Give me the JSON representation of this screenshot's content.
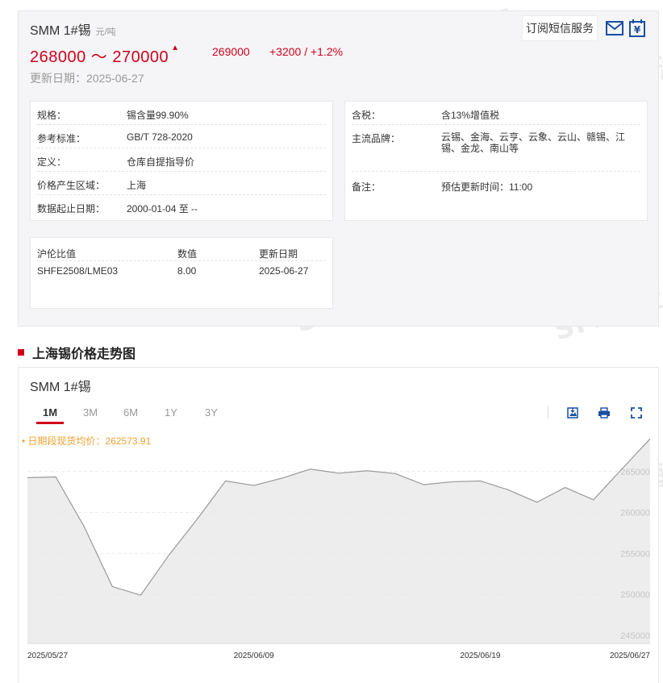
{
  "product": {
    "name": "SMM 1#锡",
    "unit": "元/吨",
    "price_range": "268000 ～ 270000",
    "avg_price": "269000",
    "change": "+3200 / +1.2%",
    "update_label": "更新日期：",
    "update_date": "2025-06-27"
  },
  "actions": {
    "subscribe_label": "订阅短信服务",
    "mail_icon": "mail-icon",
    "yuan_icon": "yuan-icon"
  },
  "watermark": "SMM 上海有色网",
  "specs_left": [
    {
      "key": "规格：",
      "value": "锡含量99.90%"
    },
    {
      "key": "参考标准：",
      "value": "GB/T 728-2020"
    },
    {
      "key": "定义：",
      "value": "仓库自提指导价"
    },
    {
      "key": "价格产生区域：",
      "value": "上海"
    },
    {
      "key": "数据起止日期：",
      "value": "2000-01-04 至 --"
    }
  ],
  "specs_right": [
    {
      "key": "含税：",
      "value": "含13%增值税"
    },
    {
      "key": "主流品牌：",
      "value": "云锡、金海、云亨、云象、云山、赣锡、江锡、金龙、南山等"
    },
    {
      "key": "备注：",
      "value": "预估更新时间：11:00"
    }
  ],
  "ratio_table": {
    "headers": [
      "沪伦比值",
      "数值",
      "更新日期"
    ],
    "rows": [
      [
        "SHFE2508/LME03",
        "8.00",
        "2025-06-27"
      ]
    ]
  },
  "section_title": "上海锡价格走势图",
  "chart_panel": {
    "name": "SMM 1#锡",
    "tabs": [
      "1M",
      "3M",
      "6M",
      "1Y",
      "3Y"
    ],
    "active_tab": "1M",
    "tools": [
      "save-image-icon",
      "print-icon",
      "fullscreen-icon"
    ],
    "avg_label": "• 日期段现货均价：262573.91"
  },
  "chart_data": {
    "type": "area",
    "x": [
      "2025-05-27",
      "2025-05-28",
      "2025-05-29",
      "2025-05-30",
      "2025-06-03",
      "2025-06-04",
      "2025-06-05",
      "2025-06-06",
      "2025-06-09",
      "2025-06-10",
      "2025-06-11",
      "2025-06-12",
      "2025-06-13",
      "2025-06-16",
      "2025-06-17",
      "2025-06-18",
      "2025-06-19",
      "2025-06-20",
      "2025-06-23",
      "2025-06-24",
      "2025-06-25",
      "2025-06-26",
      "2025-06-27"
    ],
    "values": [
      264250,
      264350,
      258300,
      250950,
      249900,
      254800,
      259200,
      263850,
      263300,
      264200,
      265300,
      264800,
      265100,
      264750,
      263400,
      263750,
      263850,
      262750,
      261250,
      263050,
      261550,
      265300,
      269000
    ],
    "xticks": [
      "2025/05/27",
      "2025/06/09",
      "2025/06/19",
      "2025/06/27"
    ],
    "yticks": [
      245000,
      250000,
      255000,
      260000,
      265000
    ],
    "ylim": [
      244000,
      270000
    ],
    "series_color": "#999999",
    "fill_color": "#e9e9e9"
  }
}
